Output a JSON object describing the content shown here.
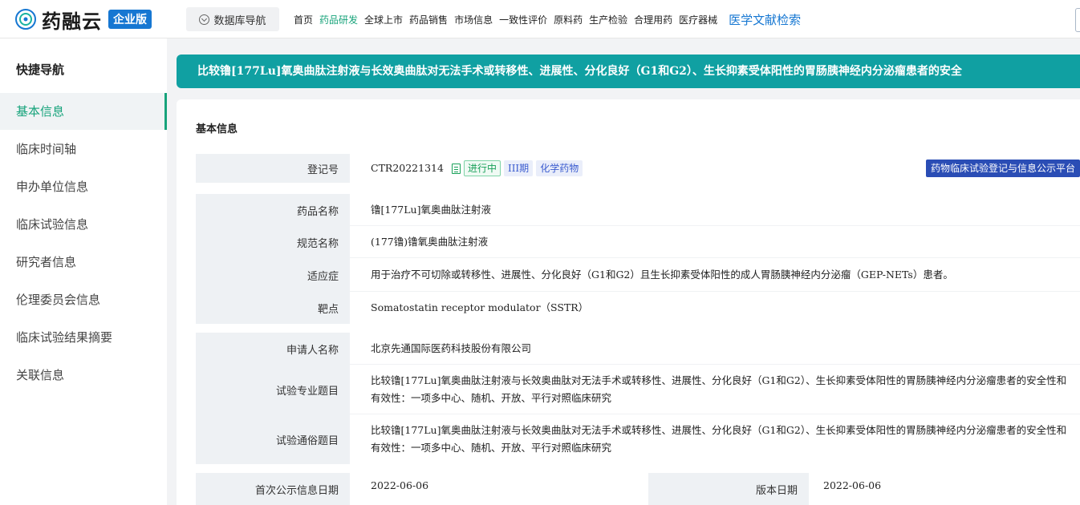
{
  "header": {
    "logo_text": "药融云",
    "badge": "企业版",
    "db_nav": "数据库导航",
    "menu": [
      {
        "label": "首页",
        "active": false
      },
      {
        "label": "药品研发",
        "active": true
      },
      {
        "label": "全球上市",
        "active": false
      },
      {
        "label": "药品销售",
        "active": false
      },
      {
        "label": "市场信息",
        "active": false
      },
      {
        "label": "一致性评价",
        "active": false
      },
      {
        "label": "原料药",
        "active": false
      },
      {
        "label": "生产检验",
        "active": false
      },
      {
        "label": "合理用药",
        "active": false
      },
      {
        "label": "医疗器械",
        "active": false
      }
    ],
    "literature": "医学文献检索"
  },
  "sidebar": {
    "title": "快捷导航",
    "items": [
      {
        "label": "基本信息",
        "active": true
      },
      {
        "label": "临床时间轴",
        "active": false
      },
      {
        "label": "申办单位信息",
        "active": false
      },
      {
        "label": "临床试验信息",
        "active": false
      },
      {
        "label": "研究者信息",
        "active": false
      },
      {
        "label": "伦理委员会信息",
        "active": false
      },
      {
        "label": "临床试验结果摘要",
        "active": false
      },
      {
        "label": "关联信息",
        "active": false
      }
    ]
  },
  "banner": "比较镥[177Lu]氧奥曲肽注射液与长效奥曲肽对无法手术或转移性、进展性、分化良好（G1和G2）、生长抑素受体阳性的胃肠胰神经内分泌瘤患者的安全",
  "section_title": "基本信息",
  "reg": {
    "label": "登记号",
    "value": "CTR20221314",
    "tags": [
      "进行中",
      "III期",
      "化学药物"
    ],
    "platform": "药物临床试验登记与信息公示平台"
  },
  "fields": {
    "drug_name": {
      "label": "药品名称",
      "value": "镥[177Lu]氧奥曲肽注射液"
    },
    "standard_name": {
      "label": "规范名称",
      "value": "(177镥)镥氧奥曲肽注射液"
    },
    "indication": {
      "label": "适应症",
      "value": "用于治疗不可切除或转移性、进展性、分化良好（G1和G2）且生长抑素受体阳性的成人胃肠胰神经内分泌瘤（GEP-NETs）患者。"
    },
    "target": {
      "label": "靶点",
      "value": "Somatostatin receptor modulator（SSTR）"
    },
    "applicant": {
      "label": "申请人名称",
      "value": "北京先通国际医药科技股份有限公司"
    },
    "pro_title": {
      "label": "试验专业题目",
      "value": "比较镥[177Lu]氧奥曲肽注射液与长效奥曲肽对无法手术或转移性、进展性、分化良好（G1和G2）、生长抑素受体阳性的胃肠胰神经内分泌瘤患者的安全性和有效性：一项多中心、随机、开放、平行对照临床研究"
    },
    "pop_title": {
      "label": "试验通俗题目",
      "value": "比较镥[177Lu]氧奥曲肽注射液与长效奥曲肽对无法手术或转移性、进展性、分化良好（G1和G2）、生长抑素受体阳性的胃肠胰神经内分泌瘤患者的安全性和有效性：一项多中心、随机、开放、平行对照临床研究"
    },
    "first_pub": {
      "label": "首次公示信息日期",
      "value": "2022-06-06"
    },
    "version_date": {
      "label": "版本日期",
      "value": "2022-06-06"
    }
  },
  "colors": {
    "accent": "#16a37b",
    "banner": "#10a0a2",
    "brand_blue": "#1677d2",
    "platform": "#2a4db5"
  }
}
